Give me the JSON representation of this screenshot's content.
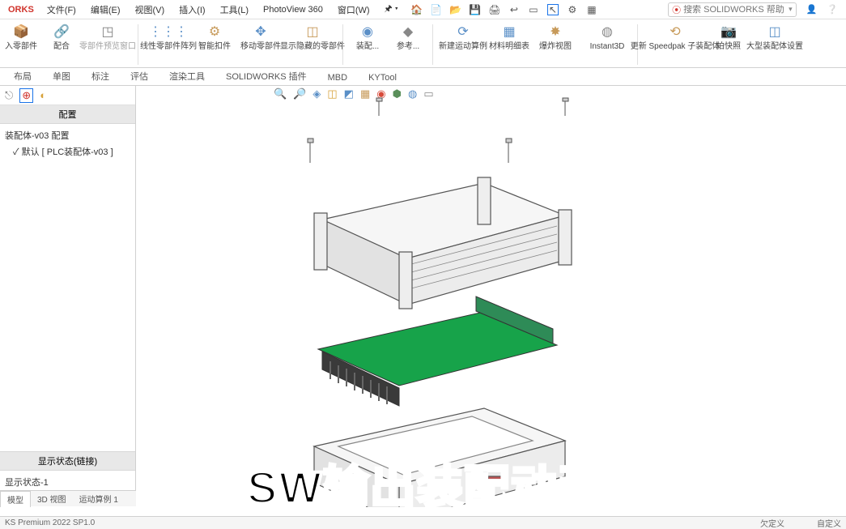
{
  "app": {
    "partial_name": "ORKS"
  },
  "menu": {
    "file": "文件(F)",
    "edit": "编辑(E)",
    "view": "视图(V)",
    "insert": "插入(I)",
    "tools": "工具(L)",
    "photoview": "PhotoView 360",
    "window": "窗口(W)"
  },
  "search": {
    "placeholder": "搜索 SOLIDWORKS 帮助"
  },
  "ribbon": {
    "insert_comp": "入零部件",
    "mate": "配合",
    "preview": "零部件预览窗口",
    "linear_pattern": "线性零部件阵列",
    "smart_fasten": "智能扣件",
    "move_comp": "移动零部件",
    "show_hidden": "显示隐藏的零部件",
    "asm": "装配...",
    "ref": "参考...",
    "motion": "新建运动算例",
    "bom": "材料明细表",
    "exploded": "爆炸视图",
    "instant3d": "Instant3D",
    "speedpak": "更新 Speedpak 子装配体",
    "snapshot": "拍快照",
    "large_asm": "大型装配体设置"
  },
  "tabs": {
    "layout": "布局",
    "sketch": "单图",
    "annot": "标注",
    "eval": "评估",
    "render": "渲染工具",
    "plugins": "SOLIDWORKS 插件",
    "mbd": "MBD",
    "kytool": "KYTool"
  },
  "sidebar": {
    "config_header": "配置",
    "root": "装配体-v03 配置",
    "child": "默认 [ PLC装配体-v03 ]",
    "display_state_header": "显示状态(链接)",
    "display_state_item": "显示状态-1"
  },
  "bottom_tabs": {
    "model": "模型",
    "view3d": "3D 视图",
    "motion1": "运动算例 1"
  },
  "status": {
    "product": "KS Premium 2022 SP1.0",
    "under": "欠定义",
    "custom": "自定义"
  },
  "overlay": "SW输出装配动画"
}
